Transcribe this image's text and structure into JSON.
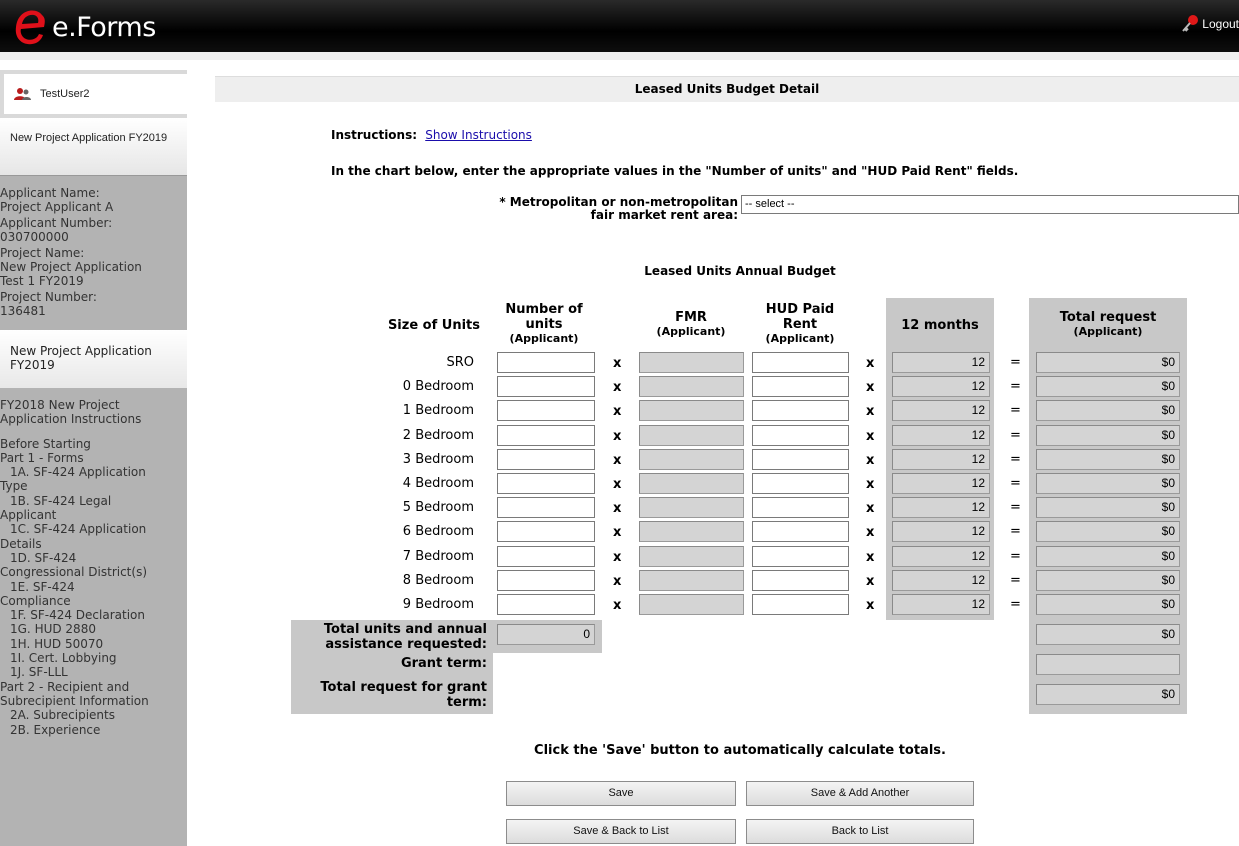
{
  "app": {
    "title": "e.Forms",
    "logout_label": "Logout"
  },
  "sidebar": {
    "user": "TestUser2",
    "project_header": "New Project Application FY2019",
    "info": {
      "applicant_name_label": "Applicant Name:",
      "applicant_name": "Project Applicant A",
      "applicant_number_label": "Applicant Number:",
      "applicant_number": "030700000",
      "project_name_label": "Project Name:",
      "project_name_1": "New Project Application",
      "project_name_2": "Test 1 FY2019",
      "project_number_label": "Project Number:",
      "project_number": "136481"
    },
    "project_header_2": "New Project Application FY2019",
    "nav": {
      "instructions_1": "FY2018 New Project",
      "instructions_2": "Application Instructions",
      "before_starting": "Before Starting",
      "part1": "Part 1 - Forms",
      "i1a_1": "1A. SF-424 Application",
      "i1a_2": "Type",
      "i1b_1": "1B. SF-424 Legal",
      "i1b_2": "Applicant",
      "i1c_1": "1C. SF-424 Application",
      "i1c_2": "Details",
      "i1d_1": "1D. SF-424",
      "i1d_2": "Congressional District(s)",
      "i1e_1": "1E. SF-424",
      "i1e_2": "Compliance",
      "i1f": "1F. SF-424 Declaration",
      "i1g": "1G. HUD 2880",
      "i1h": "1H. HUD 50070",
      "i1i": "1I. Cert. Lobbying",
      "i1j": "1J. SF-LLL",
      "part2_1": "Part 2 - Recipient and",
      "part2_2": "Subrecipient Information",
      "i2a": "2A. Subrecipients",
      "i2b": "2B. Experience"
    }
  },
  "page": {
    "title": "Leased Units Budget Detail",
    "instructions_label": "Instructions:",
    "show_instructions": "Show Instructions",
    "chart_instruction": "In the chart below, enter the appropriate values in the \"Number of units\" and \"HUD Paid Rent\" fields.",
    "fmr_label_1": "* Metropolitan or non-metropolitan",
    "fmr_label_2": "fair market rent area:",
    "fmr_select_value": "-- select --",
    "budget_title": "Leased Units Annual Budget"
  },
  "table": {
    "headers": {
      "size": "Size of Units",
      "units_1": "Number of",
      "units_2": "units",
      "units_sub": "(Applicant)",
      "fmr": "FMR",
      "fmr_sub": "(Applicant)",
      "rent_1": "HUD Paid",
      "rent_2": "Rent",
      "rent_sub": "(Applicant)",
      "months": "12 months",
      "total": "Total request",
      "total_sub": "(Applicant)"
    },
    "operator_x": "x",
    "operator_eq": "=",
    "rows": [
      {
        "label": "SRO",
        "months": "12",
        "total": "$0"
      },
      {
        "label": "0 Bedroom",
        "months": "12",
        "total": "$0"
      },
      {
        "label": "1 Bedroom",
        "months": "12",
        "total": "$0"
      },
      {
        "label": "2 Bedroom",
        "months": "12",
        "total": "$0"
      },
      {
        "label": "3 Bedroom",
        "months": "12",
        "total": "$0"
      },
      {
        "label": "4 Bedroom",
        "months": "12",
        "total": "$0"
      },
      {
        "label": "5 Bedroom",
        "months": "12",
        "total": "$0"
      },
      {
        "label": "6 Bedroom",
        "months": "12",
        "total": "$0"
      },
      {
        "label": "7 Bedroom",
        "months": "12",
        "total": "$0"
      },
      {
        "label": "8 Bedroom",
        "months": "12",
        "total": "$0"
      },
      {
        "label": "9 Bedroom",
        "months": "12",
        "total": "$0"
      }
    ],
    "totals": {
      "units_label_1": "Total units and annual",
      "units_label_2": "assistance requested:",
      "units_value": "0",
      "annual_total": "$0",
      "grant_term_label": "Grant term:",
      "grant_term_value": "",
      "grant_total_label_1": "Total request for grant",
      "grant_total_label_2": "term:",
      "grant_total_value": "$0"
    }
  },
  "footer": {
    "note": "Click the 'Save' button to automatically calculate totals.",
    "save": "Save",
    "save_add": "Save & Add Another",
    "save_back": "Save & Back to List",
    "back": "Back to List"
  }
}
